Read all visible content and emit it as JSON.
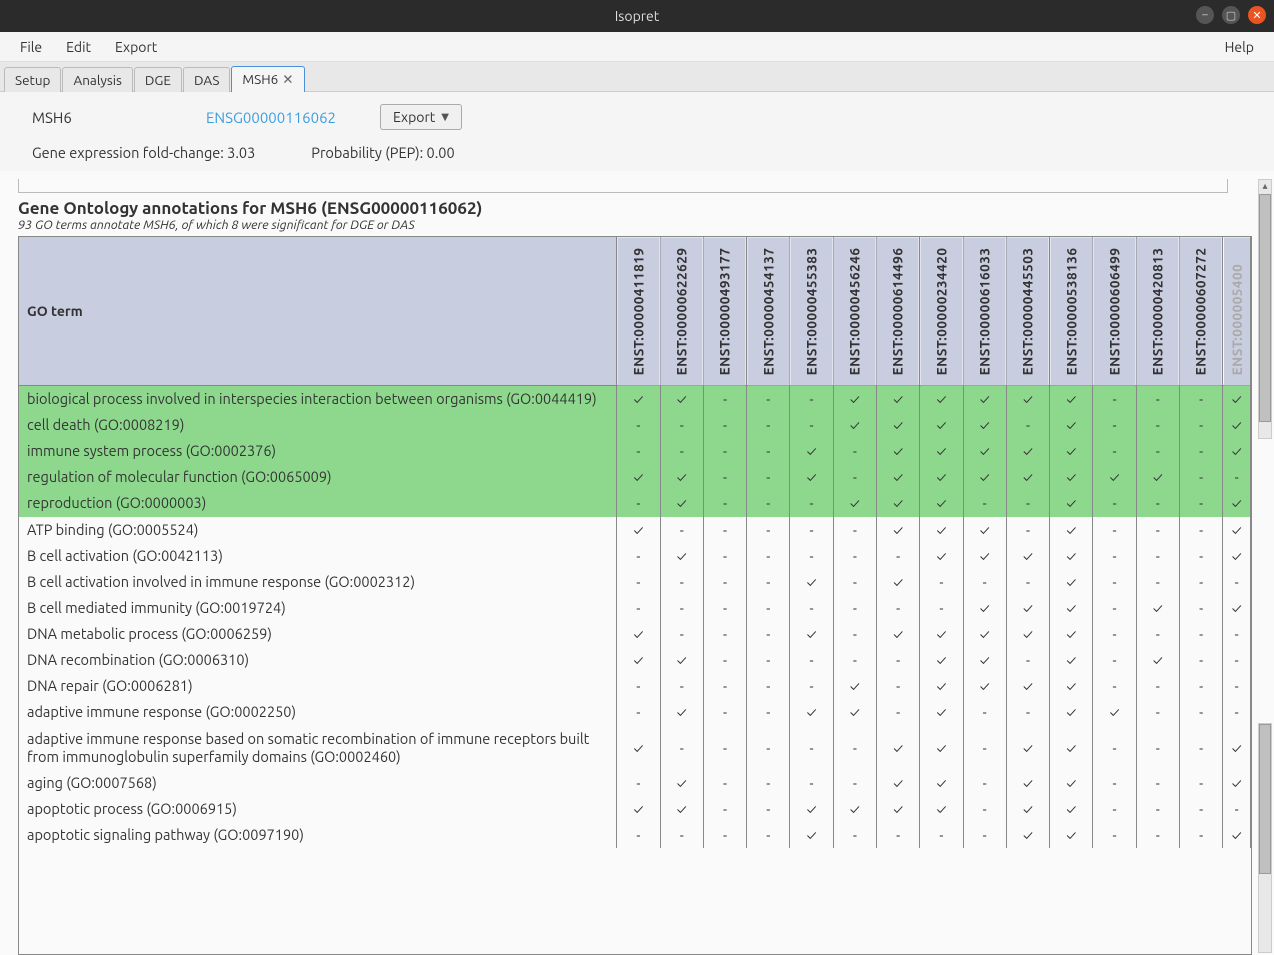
{
  "window_title": "Isopret",
  "menu": {
    "file": "File",
    "edit": "Edit",
    "export": "Export",
    "help": "Help"
  },
  "tabs": [
    {
      "label": "Setup"
    },
    {
      "label": "Analysis"
    },
    {
      "label": "DGE"
    },
    {
      "label": "DAS"
    },
    {
      "label": "MSH6",
      "closable": true,
      "active": true
    }
  ],
  "header": {
    "gene": "MSH6",
    "ensembl": "ENSG00000116062",
    "export_label": "Export",
    "fold_change_label": "Gene expression fold-change: 3.03",
    "pep_label": "Probability (PEP): 0.00"
  },
  "go_section": {
    "title": "Gene Ontology annotations for MSH6 (ENSG00000116062)",
    "subtitle": "93 GO terms annotate MSH6, of which 8 were significant for DGE or DAS",
    "col_header": "GO term",
    "columns": [
      "ENST:00000411819",
      "ENST:00000622629",
      "ENST:00000493177",
      "ENST:00000454137",
      "ENST:00000455383",
      "ENST:00000456246",
      "ENST:00000614496",
      "ENST:00000234420",
      "ENST:00000616033",
      "ENST:00000445503",
      "ENST:00000538136",
      "ENST:00000606499",
      "ENST:00000420813",
      "ENST:00000607272"
    ],
    "partial_col": "ENST:000005400",
    "rows": [
      {
        "sig": true,
        "label": "biological process involved in interspecies interaction between organisms (GO:0044419)",
        "v": [
          "✓",
          "✓",
          "-",
          "-",
          "-",
          "✓",
          "✓",
          "✓",
          "✓",
          "✓",
          "✓",
          "-",
          "-",
          "-"
        ],
        "p": "✓"
      },
      {
        "sig": true,
        "label": "cell death (GO:0008219)",
        "v": [
          "-",
          "-",
          "-",
          "-",
          "-",
          "✓",
          "✓",
          "✓",
          "✓",
          "-",
          "✓",
          "-",
          "-",
          "-"
        ],
        "p": "✓"
      },
      {
        "sig": true,
        "label": "immune system process (GO:0002376)",
        "v": [
          "-",
          "-",
          "-",
          "-",
          "✓",
          "-",
          "✓",
          "✓",
          "✓",
          "✓",
          "✓",
          "-",
          "-",
          "-"
        ],
        "p": "✓"
      },
      {
        "sig": true,
        "label": "regulation of molecular function (GO:0065009)",
        "v": [
          "✓",
          "✓",
          "-",
          "-",
          "✓",
          "-",
          "✓",
          "✓",
          "✓",
          "✓",
          "✓",
          "✓",
          "✓",
          "-"
        ],
        "p": "-"
      },
      {
        "sig": true,
        "label": "reproduction (GO:0000003)",
        "v": [
          "-",
          "✓",
          "-",
          "-",
          "-",
          "✓",
          "✓",
          "✓",
          "-",
          "-",
          "✓",
          "-",
          "-",
          "-"
        ],
        "p": "✓"
      },
      {
        "sig": false,
        "label": "ATP binding (GO:0005524)",
        "v": [
          "✓",
          "-",
          "-",
          "-",
          "-",
          "-",
          "✓",
          "✓",
          "✓",
          "-",
          "✓",
          "-",
          "-",
          "-"
        ],
        "p": "✓"
      },
      {
        "sig": false,
        "label": "B cell activation (GO:0042113)",
        "v": [
          "-",
          "✓",
          "-",
          "-",
          "-",
          "-",
          "-",
          "✓",
          "✓",
          "✓",
          "✓",
          "-",
          "-",
          "-"
        ],
        "p": "✓"
      },
      {
        "sig": false,
        "label": "B cell activation involved in immune response (GO:0002312)",
        "v": [
          "-",
          "-",
          "-",
          "-",
          "✓",
          "-",
          "✓",
          "-",
          "-",
          "-",
          "✓",
          "-",
          "-",
          "-"
        ],
        "p": "-"
      },
      {
        "sig": false,
        "label": "B cell mediated immunity (GO:0019724)",
        "v": [
          "-",
          "-",
          "-",
          "-",
          "-",
          "-",
          "-",
          "-",
          "✓",
          "✓",
          "✓",
          "-",
          "✓",
          "-"
        ],
        "p": "✓"
      },
      {
        "sig": false,
        "label": "DNA metabolic process (GO:0006259)",
        "v": [
          "✓",
          "-",
          "-",
          "-",
          "✓",
          "-",
          "✓",
          "✓",
          "✓",
          "✓",
          "✓",
          "-",
          "-",
          "-"
        ],
        "p": "-"
      },
      {
        "sig": false,
        "label": "DNA recombination (GO:0006310)",
        "v": [
          "✓",
          "✓",
          "-",
          "-",
          "-",
          "-",
          "-",
          "✓",
          "✓",
          "-",
          "✓",
          "-",
          "✓",
          "-"
        ],
        "p": "-"
      },
      {
        "sig": false,
        "label": "DNA repair (GO:0006281)",
        "v": [
          "-",
          "-",
          "-",
          "-",
          "-",
          "✓",
          "-",
          "✓",
          "✓",
          "✓",
          "✓",
          "-",
          "-",
          "-"
        ],
        "p": "-"
      },
      {
        "sig": false,
        "label": "adaptive immune response (GO:0002250)",
        "v": [
          "-",
          "✓",
          "-",
          "-",
          "✓",
          "✓",
          "-",
          "✓",
          "-",
          "-",
          "✓",
          "✓",
          "-",
          "-"
        ],
        "p": "-"
      },
      {
        "sig": false,
        "label": "adaptive immune response based on somatic recombination of immune receptors built from immunoglobulin superfamily domains (GO:0002460)",
        "v": [
          "✓",
          "-",
          "-",
          "-",
          "-",
          "-",
          "✓",
          "✓",
          "-",
          "✓",
          "✓",
          "-",
          "-",
          "-"
        ],
        "p": "✓"
      },
      {
        "sig": false,
        "label": "aging (GO:0007568)",
        "v": [
          "-",
          "✓",
          "-",
          "-",
          "-",
          "-",
          "✓",
          "✓",
          "-",
          "✓",
          "✓",
          "-",
          "-",
          "-"
        ],
        "p": "✓"
      },
      {
        "sig": false,
        "label": "apoptotic process (GO:0006915)",
        "v": [
          "✓",
          "✓",
          "-",
          "-",
          "✓",
          "✓",
          "✓",
          "✓",
          "-",
          "✓",
          "✓",
          "-",
          "-",
          "-"
        ],
        "p": "-"
      },
      {
        "sig": false,
        "label": "apoptotic signaling pathway (GO:0097190)",
        "v": [
          "-",
          "-",
          "-",
          "-",
          "✓",
          "-",
          "-",
          "-",
          "-",
          "✓",
          "✓",
          "-",
          "-",
          "-"
        ],
        "p": "✓"
      }
    ]
  }
}
